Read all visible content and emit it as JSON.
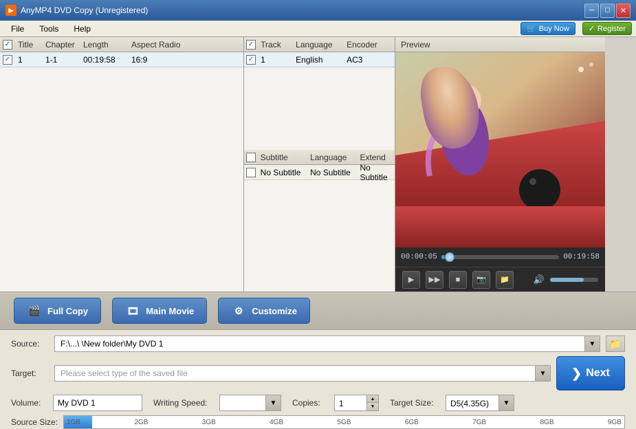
{
  "app": {
    "title": "AnyMP4 DVD Copy (Unregistered)",
    "buy_label": "Buy Now",
    "register_label": "Register"
  },
  "menu": {
    "file": "File",
    "tools": "Tools",
    "help": "Help"
  },
  "table": {
    "headers": {
      "title": "Title",
      "chapter": "Chapter",
      "length": "Length",
      "aspect_radio": "Aspect Radio"
    },
    "rows": [
      {
        "checked": true,
        "title": "1",
        "chapter": "1-1",
        "length": "00:19:58",
        "aspect": "16:9"
      }
    ]
  },
  "track_table": {
    "header": "Track",
    "lang_header": "Language",
    "enc_header": "Encoder",
    "rows": [
      {
        "checked": true,
        "track": "1",
        "language": "English",
        "encoder": "AC3"
      }
    ]
  },
  "subtitle_table": {
    "header": "Subtitle",
    "lang_header": "Language",
    "extend_header": "Extend",
    "rows": [
      {
        "checked": false,
        "subtitle": "No Subtitle",
        "language": "No Subtitle",
        "extend": "No Subtitle"
      }
    ]
  },
  "preview": {
    "header": "Preview",
    "time_start": "00:00:05",
    "time_end": "00:19:58"
  },
  "copy_buttons": {
    "full_copy": "Full Copy",
    "main_movie": "Main Movie",
    "customize": "Customize"
  },
  "settings": {
    "source_label": "Source:",
    "source_value": "F:\\...\\  \\New folder\\My DVD 1",
    "target_label": "Target:",
    "target_placeholder": "Please select type of the saved file",
    "volume_label": "Volume:",
    "volume_value": "My DVD 1",
    "writing_speed_label": "Writing Speed:",
    "copies_label": "Copies:",
    "copies_value": "1",
    "target_size_label": "Target Size:",
    "target_size_value": "D5(4.35G)",
    "source_size_label": "Source Size:",
    "next_label": "Next"
  },
  "size_bar": {
    "labels": [
      "1GB",
      "2GB",
      "3GB",
      "4GB",
      "5GB",
      "6GB",
      "7GB",
      "8GB",
      "9GB"
    ]
  },
  "colors": {
    "titlebar_start": "#4a7eb5",
    "titlebar_end": "#2b5a9b",
    "accent_blue": "#3a6ab0",
    "next_blue": "#1860c0"
  }
}
